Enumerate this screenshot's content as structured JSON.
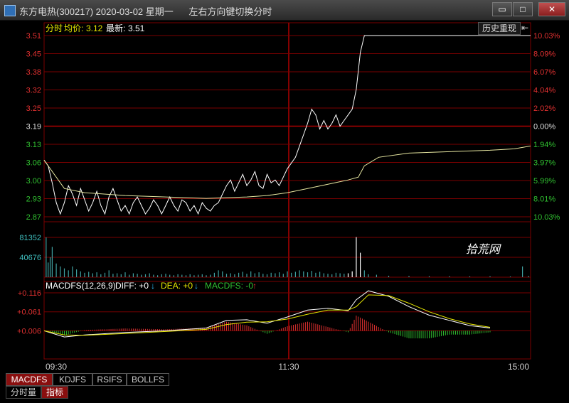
{
  "window": {
    "title": "东方电热(300217) 2020-03-02 星期一      左右方向键切换分时",
    "buttons": [
      "▭",
      "□",
      "✕"
    ]
  },
  "chart_header": {
    "label_prefix": "分时",
    "avg_label": "均价:",
    "avg_value": "3.12",
    "latest_label": "最新:",
    "latest_value": "3.51",
    "history_button": "历史重现",
    "history_arrow": "⇤"
  },
  "price_axis": {
    "left": [
      {
        "label": "3.51",
        "color": "#e03030"
      },
      {
        "label": "3.45",
        "color": "#e03030"
      },
      {
        "label": "3.38",
        "color": "#e03030"
      },
      {
        "label": "3.32",
        "color": "#e03030"
      },
      {
        "label": "3.25",
        "color": "#e03030"
      },
      {
        "label": "3.19",
        "color": "#dddddd"
      },
      {
        "label": "3.13",
        "color": "#30c030"
      },
      {
        "label": "3.06",
        "color": "#30c030"
      },
      {
        "label": "3.00",
        "color": "#30c030"
      },
      {
        "label": "2.93",
        "color": "#30c030"
      },
      {
        "label": "2.87",
        "color": "#30c030"
      }
    ],
    "right": [
      {
        "label": "10.03%",
        "color": "#e03030"
      },
      {
        "label": "8.09%",
        "color": "#e03030"
      },
      {
        "label": "6.07%",
        "color": "#e03030"
      },
      {
        "label": "4.04%",
        "color": "#e03030"
      },
      {
        "label": "2.02%",
        "color": "#e03030"
      },
      {
        "label": "0.00%",
        "color": "#dddddd"
      },
      {
        "label": "1.94%",
        "color": "#30c030"
      },
      {
        "label": "3.97%",
        "color": "#30c030"
      },
      {
        "label": "5.99%",
        "color": "#30c030"
      },
      {
        "label": "8.01%",
        "color": "#30c030"
      },
      {
        "label": "10.03%",
        "color": "#30c030"
      }
    ]
  },
  "volume_axis": {
    "labels": [
      "81352",
      "40676"
    ]
  },
  "watermark": "拾荒网",
  "macd_header": {
    "name": "MACDFS(12,26,9)",
    "diff": "DIFF: +0",
    "dea": "DEA: +0",
    "macdfs": "MACDFS: -0"
  },
  "macd_axis": {
    "labels": [
      "+0.116",
      "+0.061",
      "+0.006"
    ]
  },
  "time_axis": {
    "labels": [
      "09:30",
      "11:30",
      "15:00"
    ]
  },
  "indicator_tabs": [
    "MACDFS",
    "KDJFS",
    "RSIFS",
    "BOLLFS"
  ],
  "bottom_tabs": [
    "分时量",
    "指标"
  ],
  "colors": {
    "up": "#e03030",
    "down": "#30c030",
    "grid": "#7a0000",
    "price_line": "#ffffff",
    "avg_line": "#e6e6a0",
    "volume": "#40a0a0",
    "diff_line": "#ffffff",
    "dea_line": "#e6e600"
  },
  "chart_data": {
    "type": "line",
    "title": "东方电热(300217) 2020-03-02",
    "prev_close": 3.19,
    "ylim": [
      2.87,
      3.51
    ],
    "session_minutes": 240,
    "price_series": [
      [
        0,
        3.07
      ],
      [
        2,
        3.05
      ],
      [
        4,
        2.99
      ],
      [
        6,
        2.92
      ],
      [
        8,
        2.88
      ],
      [
        10,
        2.92
      ],
      [
        12,
        2.98
      ],
      [
        14,
        2.95
      ],
      [
        16,
        2.91
      ],
      [
        18,
        2.97
      ],
      [
        20,
        2.93
      ],
      [
        22,
        2.89
      ],
      [
        24,
        2.92
      ],
      [
        26,
        2.96
      ],
      [
        28,
        2.91
      ],
      [
        30,
        2.88
      ],
      [
        32,
        2.94
      ],
      [
        34,
        2.97
      ],
      [
        36,
        2.93
      ],
      [
        38,
        2.89
      ],
      [
        40,
        2.91
      ],
      [
        42,
        2.88
      ],
      [
        44,
        2.92
      ],
      [
        46,
        2.94
      ],
      [
        48,
        2.91
      ],
      [
        50,
        2.88
      ],
      [
        52,
        2.9
      ],
      [
        54,
        2.93
      ],
      [
        56,
        2.91
      ],
      [
        58,
        2.88
      ],
      [
        60,
        2.91
      ],
      [
        62,
        2.94
      ],
      [
        64,
        2.91
      ],
      [
        66,
        2.89
      ],
      [
        68,
        2.93
      ],
      [
        70,
        2.92
      ],
      [
        72,
        2.89
      ],
      [
        74,
        2.91
      ],
      [
        76,
        2.88
      ],
      [
        78,
        2.92
      ],
      [
        80,
        2.9
      ],
      [
        82,
        2.89
      ],
      [
        84,
        2.91
      ],
      [
        86,
        2.92
      ],
      [
        88,
        2.95
      ],
      [
        90,
        2.98
      ],
      [
        92,
        3.0
      ],
      [
        94,
        2.96
      ],
      [
        96,
        2.99
      ],
      [
        98,
        3.02
      ],
      [
        100,
        2.98
      ],
      [
        102,
        3.0
      ],
      [
        104,
        3.03
      ],
      [
        106,
        2.98
      ],
      [
        108,
        2.97
      ],
      [
        110,
        3.02
      ],
      [
        112,
        2.99
      ],
      [
        114,
        3.0
      ],
      [
        116,
        2.98
      ],
      [
        118,
        3.01
      ],
      [
        120,
        3.04
      ],
      [
        122,
        3.06
      ],
      [
        124,
        3.08
      ],
      [
        126,
        3.12
      ],
      [
        128,
        3.16
      ],
      [
        130,
        3.2
      ],
      [
        132,
        3.25
      ],
      [
        134,
        3.23
      ],
      [
        136,
        3.18
      ],
      [
        138,
        3.21
      ],
      [
        140,
        3.18
      ],
      [
        142,
        3.2
      ],
      [
        144,
        3.23
      ],
      [
        146,
        3.19
      ],
      [
        148,
        3.21
      ],
      [
        150,
        3.23
      ],
      [
        152,
        3.25
      ],
      [
        154,
        3.32
      ],
      [
        156,
        3.45
      ],
      [
        158,
        3.51
      ],
      [
        240,
        3.51
      ]
    ],
    "avg_series": [
      [
        0,
        3.07
      ],
      [
        10,
        2.97
      ],
      [
        20,
        2.955
      ],
      [
        40,
        2.945
      ],
      [
        60,
        2.94
      ],
      [
        80,
        2.935
      ],
      [
        100,
        2.94
      ],
      [
        110,
        2.945
      ],
      [
        120,
        2.955
      ],
      [
        130,
        2.97
      ],
      [
        140,
        2.985
      ],
      [
        150,
        3.0
      ],
      [
        155,
        3.01
      ],
      [
        158,
        3.05
      ],
      [
        165,
        3.08
      ],
      [
        180,
        3.095
      ],
      [
        200,
        3.1
      ],
      [
        220,
        3.105
      ],
      [
        232,
        3.11
      ],
      [
        240,
        3.12
      ]
    ],
    "volume_series": [
      [
        1,
        81352
      ],
      [
        2,
        30000
      ],
      [
        3,
        40676
      ],
      [
        4,
        62000
      ],
      [
        6,
        28000
      ],
      [
        8,
        22000
      ],
      [
        10,
        18000
      ],
      [
        12,
        14000
      ],
      [
        14,
        22000
      ],
      [
        16,
        16000
      ],
      [
        18,
        12000
      ],
      [
        20,
        9000
      ],
      [
        22,
        11000
      ],
      [
        24,
        8000
      ],
      [
        26,
        10000
      ],
      [
        28,
        6000
      ],
      [
        30,
        9000
      ],
      [
        32,
        14000
      ],
      [
        34,
        7000
      ],
      [
        36,
        8000
      ],
      [
        38,
        6000
      ],
      [
        40,
        10000
      ],
      [
        42,
        5000
      ],
      [
        44,
        8000
      ],
      [
        46,
        7000
      ],
      [
        48,
        5000
      ],
      [
        50,
        6000
      ],
      [
        52,
        8000
      ],
      [
        54,
        5000
      ],
      [
        56,
        4000
      ],
      [
        58,
        6000
      ],
      [
        60,
        7000
      ],
      [
        62,
        5000
      ],
      [
        64,
        4000
      ],
      [
        66,
        6000
      ],
      [
        68,
        5000
      ],
      [
        70,
        4000
      ],
      [
        72,
        6000
      ],
      [
        74,
        4000
      ],
      [
        76,
        5000
      ],
      [
        78,
        6000
      ],
      [
        80,
        4000
      ],
      [
        82,
        5000
      ],
      [
        84,
        9000
      ],
      [
        86,
        14000
      ],
      [
        88,
        12000
      ],
      [
        90,
        7000
      ],
      [
        92,
        8000
      ],
      [
        94,
        6000
      ],
      [
        96,
        9000
      ],
      [
        98,
        11000
      ],
      [
        100,
        7000
      ],
      [
        102,
        12000
      ],
      [
        104,
        8000
      ],
      [
        106,
        10000
      ],
      [
        108,
        7000
      ],
      [
        110,
        6000
      ],
      [
        112,
        9000
      ],
      [
        114,
        8000
      ],
      [
        116,
        10000
      ],
      [
        118,
        7000
      ],
      [
        120,
        12000
      ],
      [
        122,
        9000
      ],
      [
        124,
        11000
      ],
      [
        126,
        14000
      ],
      [
        128,
        12000
      ],
      [
        130,
        10000
      ],
      [
        132,
        13000
      ],
      [
        134,
        9000
      ],
      [
        136,
        11000
      ],
      [
        138,
        8000
      ],
      [
        140,
        7000
      ],
      [
        142,
        6000
      ],
      [
        144,
        9000
      ],
      [
        146,
        8000
      ],
      [
        148,
        7000
      ],
      [
        150,
        8000
      ],
      [
        152,
        12000
      ],
      [
        154,
        82000
      ],
      [
        156,
        50000
      ],
      [
        158,
        14000
      ],
      [
        160,
        6000
      ],
      [
        164,
        5000
      ],
      [
        170,
        3000
      ],
      [
        180,
        2500
      ],
      [
        190,
        2000
      ],
      [
        200,
        2000
      ],
      [
        210,
        1800
      ],
      [
        220,
        2000
      ],
      [
        230,
        1500
      ],
      [
        236,
        22000
      ],
      [
        239,
        2500
      ]
    ],
    "macd": {
      "ylim": [
        -0.02,
        0.116
      ],
      "diff_series": [
        [
          0,
          0.0
        ],
        [
          10,
          -0.018
        ],
        [
          20,
          -0.012
        ],
        [
          40,
          -0.005
        ],
        [
          60,
          0.0
        ],
        [
          80,
          0.008
        ],
        [
          90,
          0.03
        ],
        [
          100,
          0.032
        ],
        [
          110,
          0.022
        ],
        [
          120,
          0.04
        ],
        [
          130,
          0.06
        ],
        [
          140,
          0.065
        ],
        [
          150,
          0.058
        ],
        [
          154,
          0.09
        ],
        [
          160,
          0.116
        ],
        [
          170,
          0.1
        ],
        [
          180,
          0.07
        ],
        [
          190,
          0.045
        ],
        [
          200,
          0.03
        ],
        [
          210,
          0.015
        ],
        [
          220,
          0.008
        ]
      ],
      "dea_series": [
        [
          0,
          0.0
        ],
        [
          10,
          -0.012
        ],
        [
          20,
          -0.013
        ],
        [
          40,
          -0.008
        ],
        [
          60,
          -0.002
        ],
        [
          80,
          0.004
        ],
        [
          90,
          0.018
        ],
        [
          100,
          0.025
        ],
        [
          110,
          0.026
        ],
        [
          120,
          0.034
        ],
        [
          130,
          0.048
        ],
        [
          140,
          0.06
        ],
        [
          150,
          0.06
        ],
        [
          154,
          0.07
        ],
        [
          160,
          0.104
        ],
        [
          170,
          0.102
        ],
        [
          180,
          0.08
        ],
        [
          190,
          0.055
        ],
        [
          200,
          0.035
        ],
        [
          210,
          0.02
        ],
        [
          220,
          0.01
        ]
      ]
    }
  }
}
